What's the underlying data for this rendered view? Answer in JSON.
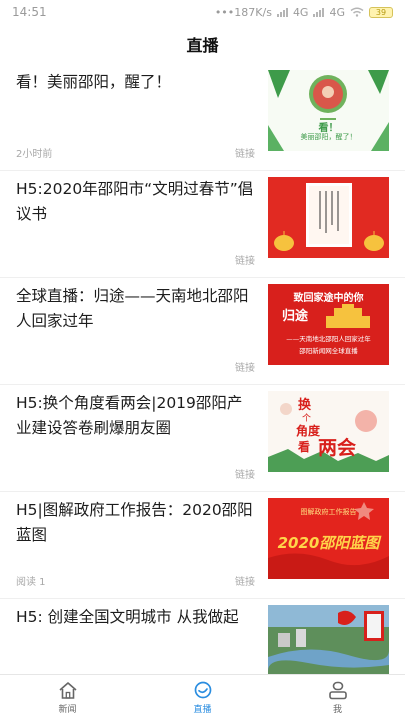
{
  "status_bar": {
    "time": "14:51",
    "speed": "•••187K/s",
    "network1": "4G",
    "network2": "4G",
    "battery": "39"
  },
  "header": {
    "title": "直播"
  },
  "items": [
    {
      "title": "看！美丽邵阳，醒了！",
      "meta": "2小时前",
      "link": "链接",
      "thumb_text_1": "看！",
      "thumb_text_2": "美丽邵阳，醒了！",
      "thumb_icon": "portrait-thumbnail-icon"
    },
    {
      "title": "H5:2020年邵阳市“文明过春节”倡议书",
      "meta": "",
      "link": "链接",
      "thumb_icon": "lantern-thumbnail-icon"
    },
    {
      "title": "全球直播：归途——天南地北邵阳人回家过年",
      "meta": "",
      "link": "链接",
      "thumb_text_1": "致回家途中的你",
      "thumb_text_2": "归途",
      "thumb_text_3": "——天南地北邵阳人回家过年",
      "thumb_text_4": "邵阳新闻网全球直播",
      "thumb_icon": "homecoming-thumbnail-icon"
    },
    {
      "title": "H5:换个角度看两会|2019邵阳产业建设答卷刷爆朋友圈",
      "meta": "",
      "link": "链接",
      "thumb_text_1": "换",
      "thumb_text_2": "个",
      "thumb_text_3": "角度",
      "thumb_text_4": "看",
      "thumb_text_5": "两会",
      "thumb_icon": "two-sessions-thumbnail-icon"
    },
    {
      "title": "H5|图解政府工作报告：2020邵阳蓝图",
      "meta": "阅读 1",
      "link": "链接",
      "thumb_text_1": "图解政府工作报告",
      "thumb_text_2": "2020邵阳蓝图",
      "thumb_icon": "blueprint-thumbnail-icon"
    },
    {
      "title": "H5: 创建全国文明城市 从我做起",
      "meta": "",
      "link": "",
      "thumb_icon": "city-aerial-thumbnail-icon"
    }
  ],
  "tabs": [
    {
      "label": "新闻",
      "icon": "home-icon",
      "active": false
    },
    {
      "label": "直播",
      "icon": "live-icon",
      "active": true
    },
    {
      "label": "我",
      "icon": "profile-icon",
      "active": false
    }
  ],
  "colors": {
    "accent": "#2a8de0",
    "thumb_red": "#d8201c",
    "thumb_green": "#3e9b4a"
  }
}
